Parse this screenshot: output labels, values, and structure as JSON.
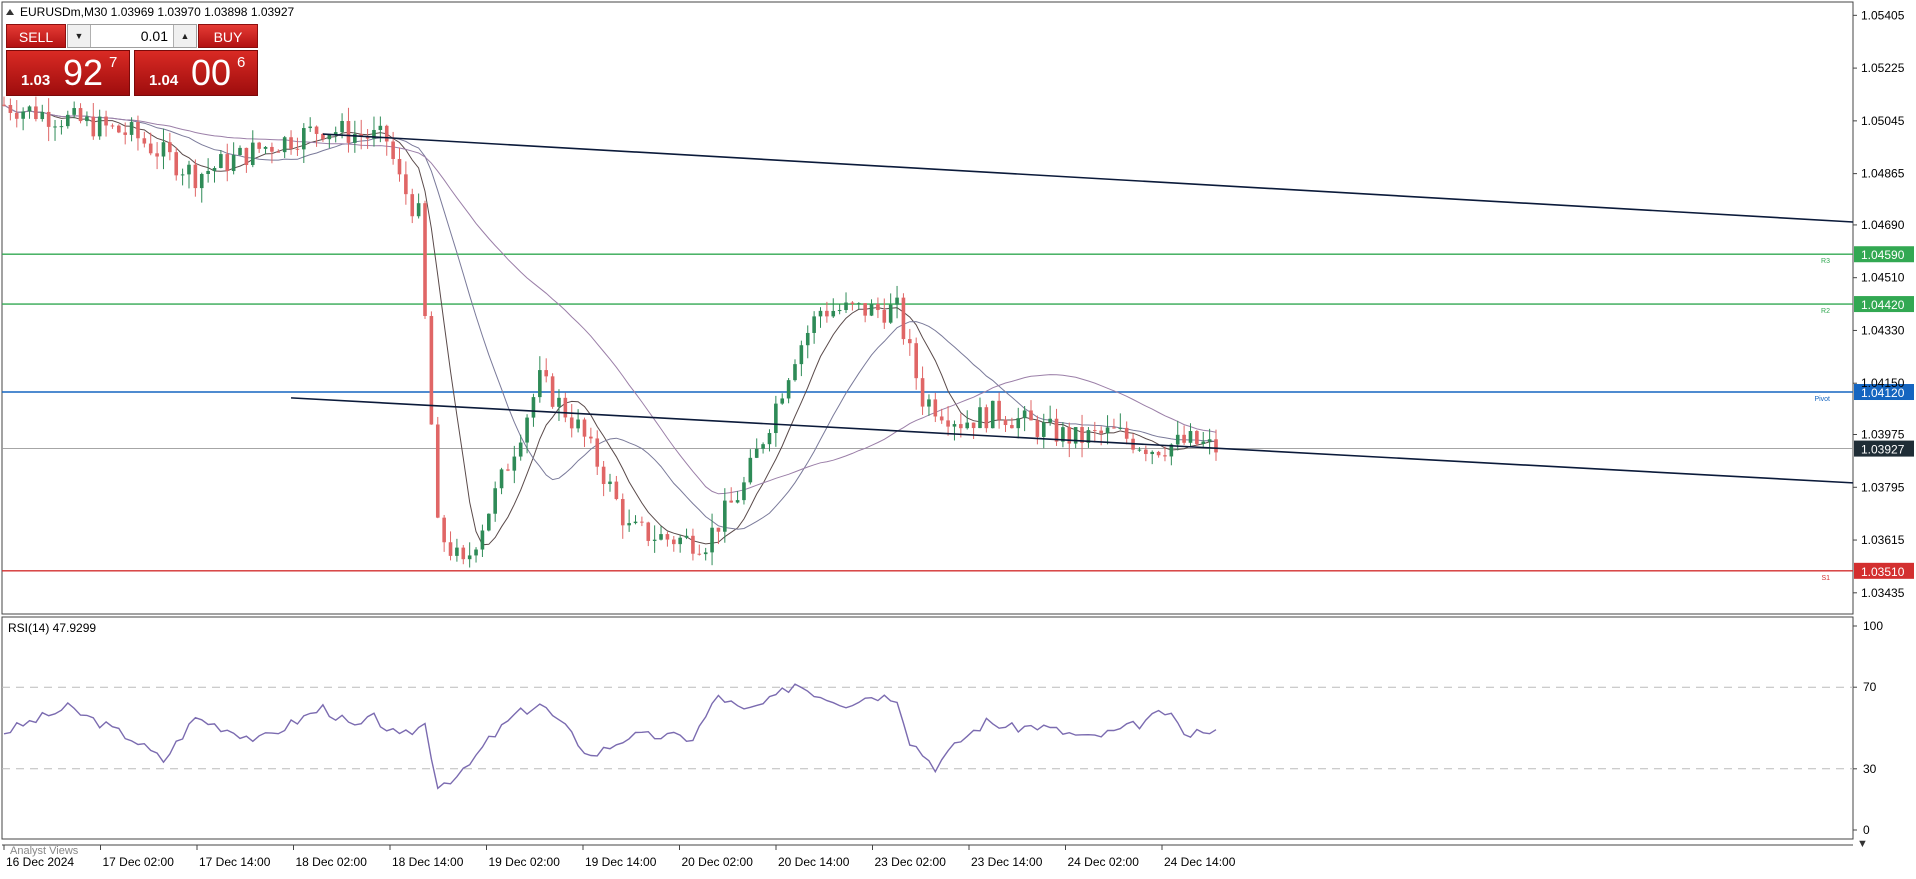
{
  "symbol_header": {
    "text": "EURUSDm,M30  1.03969 1.03970 1.03898 1.03927"
  },
  "trade_panel": {
    "sell_label": "SELL",
    "buy_label": "BUY",
    "lot_value": "0.01",
    "sell_price_small": "1.03",
    "sell_price_big": "92",
    "sell_price_sup": "7",
    "buy_price_small": "1.04",
    "buy_price_big": "00",
    "buy_price_sup": "6"
  },
  "price_axis": {
    "ticks": [
      "1.05405",
      "1.05225",
      "1.05045",
      "1.04865",
      "1.04690",
      "1.04510",
      "1.04330",
      "1.04150",
      "1.03975",
      "1.03795",
      "1.03615",
      "1.03435"
    ],
    "min": 1.0339,
    "max": 1.0543
  },
  "levels": [
    {
      "price": 1.0459,
      "label": "1.04590",
      "tag": "R3",
      "color": "#32a852"
    },
    {
      "price": 1.0442,
      "label": "1.04420",
      "tag": "R2",
      "color": "#32a852"
    },
    {
      "price": 1.0412,
      "label": "1.04120",
      "tag": "Pivot",
      "color": "#1565c0"
    },
    {
      "price": 1.0351,
      "label": "1.03510",
      "tag": "S1",
      "color": "#d32f2f"
    }
  ],
  "current_price": {
    "price": 1.03927,
    "label": "1.03927"
  },
  "rsi_panel": {
    "title": "RSI(14) 47.9299",
    "levels": [
      "100",
      "70",
      "30",
      "0"
    ]
  },
  "bottom_tab": {
    "label": "Analyst Views"
  },
  "time_axis": {
    "labels": [
      "16 Dec 2024",
      "17 Dec 02:00",
      "17 Dec 14:00",
      "18 Dec 02:00",
      "18 Dec 14:00",
      "19 Dec 02:00",
      "19 Dec 14:00",
      "20 Dec 02:00",
      "20 Dec 14:00",
      "23 Dec 02:00",
      "23 Dec 14:00",
      "24 Dec 02:00",
      "24 Dec 14:00"
    ]
  },
  "colors": {
    "bull": "#2e8b57",
    "bear": "#e06666",
    "trend": "#0b1a3a",
    "ma_fast": "#5a4a4a",
    "ma_mid": "#7a7a9a",
    "ma_slow": "#9b7fa8",
    "rsi": "#7b6bb0"
  },
  "chart_data": {
    "type": "candlestick",
    "symbol": "EURUSDm",
    "timeframe": "M30",
    "series": [
      {
        "name": "price",
        "values": [
          [
            0,
            1.051
          ],
          [
            10,
            1.0505
          ],
          [
            20,
            1.05
          ],
          [
            30,
            1.0486
          ],
          [
            40,
            1.0495
          ],
          [
            50,
            1.0502
          ],
          [
            60,
            1.0498
          ],
          [
            62,
            1.0484
          ],
          [
            65,
            1.0472
          ],
          [
            68,
            1.0365
          ],
          [
            72,
            1.0352
          ],
          [
            78,
            1.0382
          ],
          [
            84,
            1.0416
          ],
          [
            90,
            1.04
          ],
          [
            94,
            1.0384
          ],
          [
            98,
            1.0365
          ],
          [
            104,
            1.0362
          ],
          [
            110,
            1.0361
          ],
          [
            116,
            1.038
          ],
          [
            120,
            1.0402
          ],
          [
            124,
            1.0425
          ],
          [
            128,
            1.044
          ],
          [
            134,
            1.044
          ],
          [
            140,
            1.044
          ],
          [
            144,
            1.041
          ],
          [
            150,
            1.0402
          ],
          [
            156,
            1.0405
          ],
          [
            162,
            1.04
          ],
          [
            168,
            1.0396
          ],
          [
            174,
            1.0398
          ],
          [
            180,
            1.0393
          ],
          [
            186,
            1.0395
          ],
          [
            190,
            1.03927
          ]
        ]
      }
    ],
    "ylim": [
      1.0339,
      1.0543
    ],
    "rsi": {
      "name": "RSI(14)",
      "ylim": [
        0,
        100
      ],
      "values": [
        [
          0,
          48
        ],
        [
          10,
          60
        ],
        [
          20,
          45
        ],
        [
          25,
          34
        ],
        [
          30,
          55
        ],
        [
          40,
          44
        ],
        [
          50,
          60
        ],
        [
          55,
          50
        ],
        [
          58,
          55
        ],
        [
          62,
          45
        ],
        [
          66,
          52
        ],
        [
          68,
          22
        ],
        [
          72,
          28
        ],
        [
          76,
          44
        ],
        [
          80,
          56
        ],
        [
          84,
          62
        ],
        [
          88,
          50
        ],
        [
          92,
          36
        ],
        [
          98,
          46
        ],
        [
          104,
          46
        ],
        [
          108,
          45
        ],
        [
          112,
          66
        ],
        [
          116,
          58
        ],
        [
          120,
          63
        ],
        [
          124,
          72
        ],
        [
          128,
          66
        ],
        [
          132,
          62
        ],
        [
          136,
          66
        ],
        [
          140,
          65
        ],
        [
          142,
          44
        ],
        [
          146,
          31
        ],
        [
          150,
          44
        ],
        [
          154,
          53
        ],
        [
          158,
          50
        ],
        [
          162,
          51
        ],
        [
          166,
          48
        ],
        [
          170,
          45
        ],
        [
          174,
          48
        ],
        [
          178,
          52
        ],
        [
          182,
          58
        ],
        [
          186,
          45
        ],
        [
          188,
          50
        ],
        [
          190,
          48
        ]
      ]
    }
  }
}
